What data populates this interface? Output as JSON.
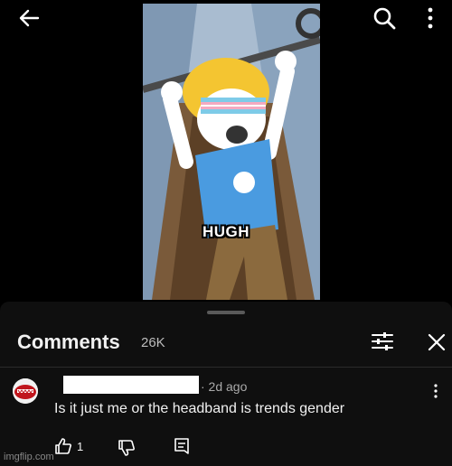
{
  "icons": {
    "back": "arrow-left-icon",
    "search": "search-icon",
    "more": "more-vert-icon",
    "filter": "filter-icon",
    "close": "close-icon",
    "like": "thumbs-up-icon",
    "dislike": "thumbs-down-icon",
    "reply": "reply-icon",
    "comment_menu": "more-vert-icon"
  },
  "video": {
    "caption": "HUGH"
  },
  "comments": {
    "title": "Comments",
    "count": "26K"
  },
  "comment": {
    "time": "· 2d ago",
    "text": "Is it just me or the headband is trends gender",
    "likes": "1"
  },
  "watermark": "imgflip.com",
  "colors": {
    "background": "#000000",
    "sheet": "#0f0f0f",
    "text": "#f1f1f1",
    "muted": "#aaaaaa"
  }
}
